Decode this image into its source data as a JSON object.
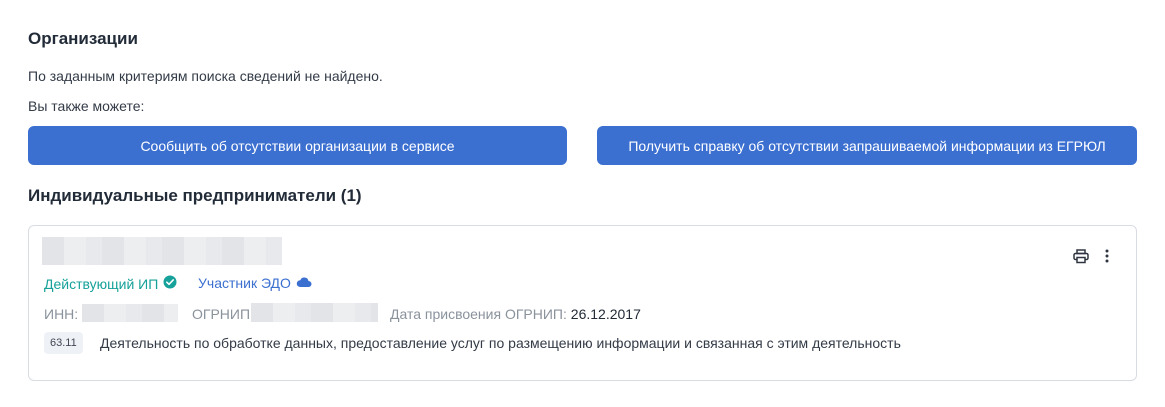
{
  "organizations": {
    "title": "Организации",
    "not_found_text": "По заданным критериям поиска сведений не найдено.",
    "also_text": "Вы также можете:",
    "report_button": "Сообщить об отсутствии организации в сервисе",
    "certificate_button": "Получить справку об отсутствии запрашиваемой информации из ЕГРЮЛ"
  },
  "entrepreneurs": {
    "title": "Индивидуальные предприниматели (1)",
    "card": {
      "status_active": "Действующий ИП",
      "status_edo": "Участник ЭДО",
      "inn_label": "ИНН:",
      "ogrnip_label": "ОГРНИП:",
      "date_label": "Дата присвоения ОГРНИП:",
      "date_value": "26.12.2017",
      "okved_code": "63.11",
      "okved_desc": "Деятельность по обработке данных, предоставление услуг по размещению информации и связанная с этим деятельность"
    }
  },
  "colors": {
    "primary": "#3b6fd0",
    "active": "#16a19a",
    "text": "#222b38"
  },
  "icons": [
    "check-circle-icon",
    "cloud-icon",
    "printer-icon",
    "more-vertical-icon"
  ]
}
